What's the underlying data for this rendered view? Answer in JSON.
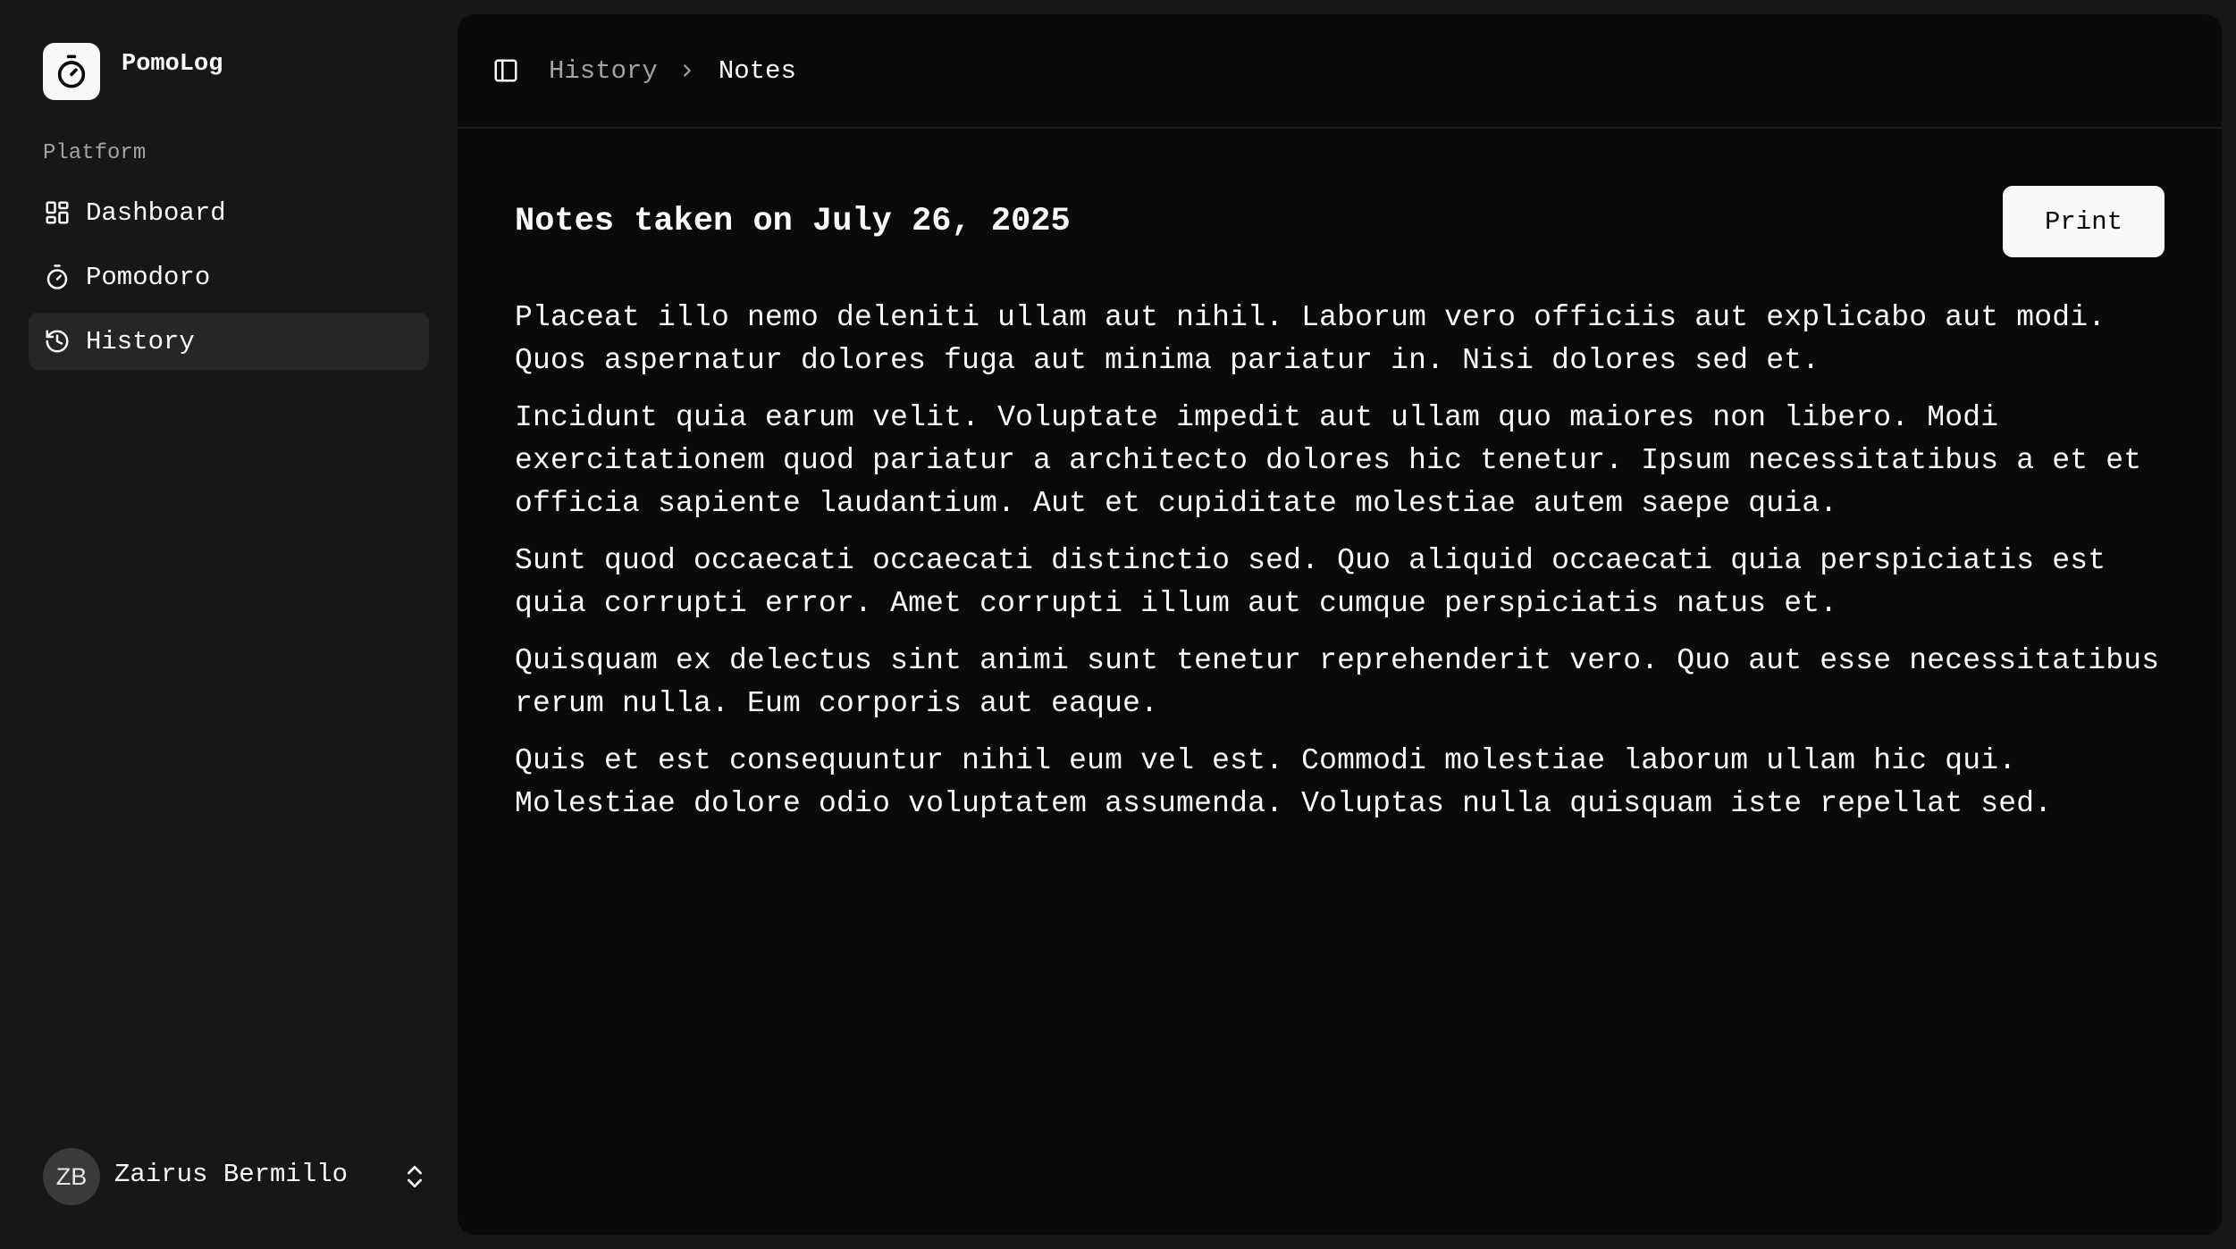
{
  "app": {
    "name": "PomoLog"
  },
  "sidebar": {
    "group_label": "Platform",
    "items": [
      {
        "label": "Dashboard",
        "icon": "dashboard-grid-icon",
        "active": false
      },
      {
        "label": "Pomodoro",
        "icon": "timer-icon",
        "active": false
      },
      {
        "label": "History",
        "icon": "history-icon",
        "active": true
      }
    ],
    "user": {
      "initials": "ZB",
      "name": "Zairus Bermillo"
    }
  },
  "topbar": {
    "breadcrumb": {
      "parent": "History",
      "current": "Notes"
    }
  },
  "page": {
    "title": "Notes taken on July 26, 2025",
    "print_label": "Print",
    "paragraphs": [
      "Placeat illo nemo deleniti ullam aut nihil. Laborum vero officiis aut explicabo aut modi. Quos aspernatur dolores fuga aut minima pariatur in. Nisi dolores sed et.",
      "Incidunt quia earum velit. Voluptate impedit aut ullam quo maiores non libero. Modi exercitationem quod pariatur a architecto dolores hic tenetur. Ipsum necessitatibus a et et officia sapiente laudantium. Aut et cupiditate molestiae autem saepe quia.",
      "Sunt quod occaecati occaecati distinctio sed. Quo aliquid occaecati quia perspiciatis est quia corrupti error. Amet corrupti illum aut cumque perspiciatis natus et.",
      "Quisquam ex delectus sint animi sunt tenetur reprehenderit vero. Quo aut esse necessitatibus rerum nulla. Eum corporis aut eaque.",
      "Quis et est consequuntur nihil eum vel est. Commodi molestiae laborum ullam hic qui. Molestiae dolore odio voluptatem assumenda. Voluptas nulla quisquam iste repellat sed."
    ]
  },
  "colors": {
    "sidebar_bg": "#171717",
    "panel_bg": "#0a0a0a",
    "active_item_bg": "#262626",
    "text": "#fafafa",
    "muted_text": "#a3a3a3"
  }
}
